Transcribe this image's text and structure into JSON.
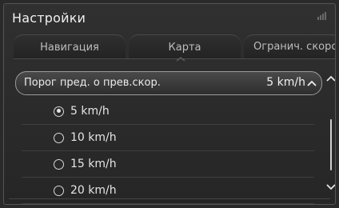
{
  "title": "Настройки",
  "tabs": [
    {
      "label": "Навигация"
    },
    {
      "label": "Карта"
    },
    {
      "label": "Огранич. скорости"
    }
  ],
  "setting": {
    "label": "Порог пред. о прев.скор.",
    "value": "5 km/h"
  },
  "options": [
    {
      "label": "5 km/h",
      "selected": true
    },
    {
      "label": "10 km/h",
      "selected": false
    },
    {
      "label": "15 km/h",
      "selected": false
    },
    {
      "label": "20 km/h",
      "selected": false
    }
  ],
  "icons": {
    "signal": "signal-icon",
    "chevron_up": "chevron-up-icon",
    "chevron_down": "chevron-down-icon"
  }
}
